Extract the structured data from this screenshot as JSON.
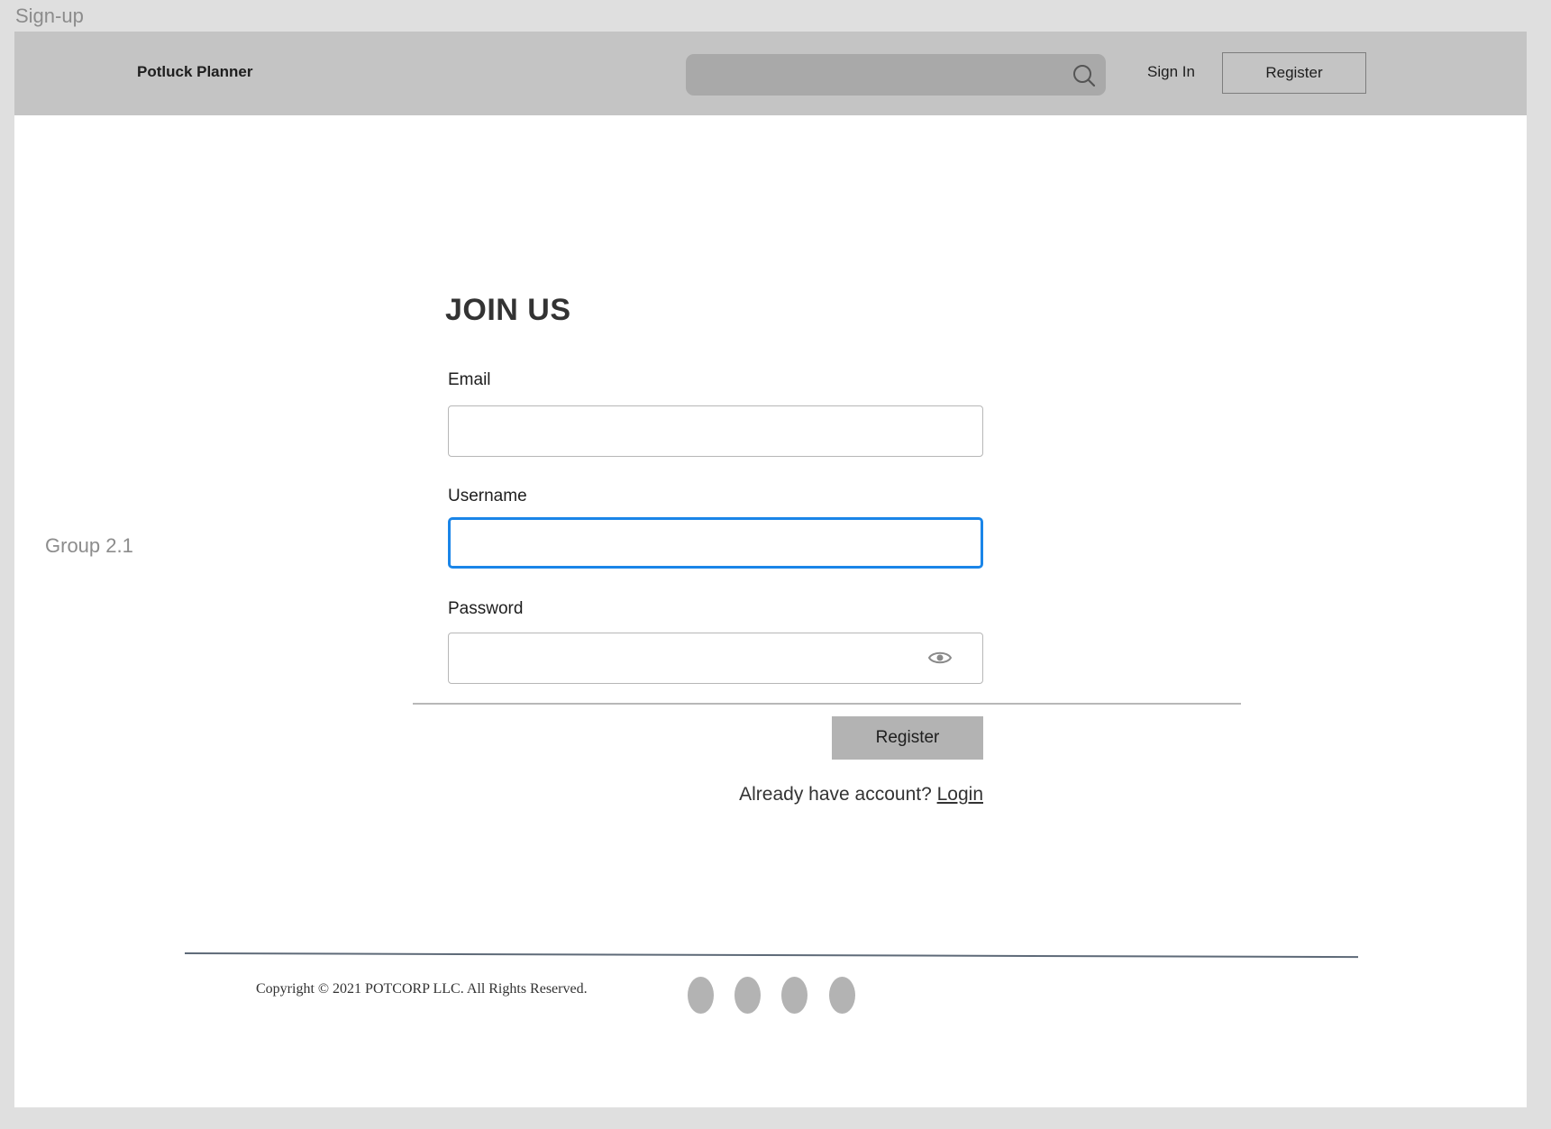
{
  "artboard": {
    "title": "Sign-up",
    "side_label": "Group 2.1"
  },
  "header": {
    "brand": "Potluck Planner",
    "search": {
      "placeholder": "",
      "icon": "search-icon"
    },
    "sign_in_label": "Sign In",
    "register_label": "Register"
  },
  "form": {
    "title": "JOIN US",
    "email": {
      "label": "Email",
      "value": ""
    },
    "username": {
      "label": "Username",
      "value": ""
    },
    "password": {
      "label": "Password",
      "value": "",
      "icon": "eye-icon"
    },
    "submit_label": "Register",
    "already_text": "Already have account?",
    "login_label": "Login"
  },
  "footer": {
    "copyright": "Copyright © 2021 POTCORP LLC. All Rights Reserved.",
    "social_icons": [
      "social-icon-1",
      "social-icon-2",
      "social-icon-3",
      "social-icon-4"
    ]
  },
  "colors": {
    "header_bg": "#c4c4c4",
    "search_bg": "#a9a9a9",
    "focus_border": "#1a85e8",
    "button_bg": "#b3b3b3"
  }
}
